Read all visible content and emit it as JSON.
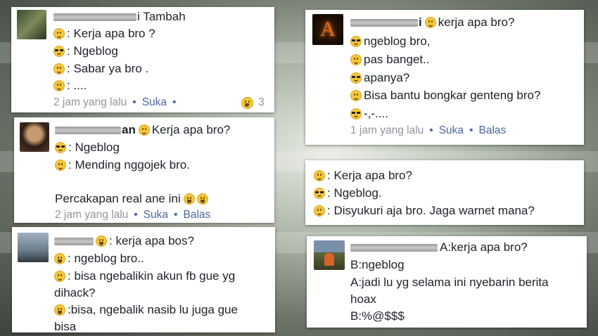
{
  "card1": {
    "name_suffix": "i Tambah",
    "lines": [
      ": Kerja apa bro ?",
      ": Ngeblog",
      ": Sabar ya bro .",
      ": ...."
    ],
    "time": "2 jam yang lalu",
    "like": "Suka",
    "reaction_count": "3"
  },
  "card2": {
    "name_suffix": "an",
    "header_text": "Kerja apa bro?",
    "lines": [
      ": Ngeblog",
      ": Mending nggojek bro."
    ],
    "note": "Percakapan real ane ini",
    "time": "2 jam yang lalu",
    "like": "Suka",
    "reply": "Balas"
  },
  "card3": {
    "header_text": ": kerja apa bos?",
    "lines": [
      ": ngeblog bro..",
      ": bisa ngebalikin akun fb gue yg",
      "dihack?",
      ":bisa, ngebalik nasib lu juga gue",
      "bisa"
    ]
  },
  "card4": {
    "header_text": "kerja apa bro?",
    "lines": [
      "ngeblog bro,",
      "pas banget..",
      "apanya?",
      "Bisa bantu bongkar genteng bro?",
      "-,-...."
    ],
    "time": "1 jam yang lalu",
    "like": "Suka",
    "reply": "Balas",
    "avatar_letter": "A"
  },
  "card5": {
    "lines": [
      ": Kerja apa bro?",
      ": Ngeblog.",
      ": Disyukuri aja bro. Jaga warnet mana?"
    ]
  },
  "card6": {
    "header_text": "A:kerja apa bro?",
    "lines": [
      "B:ngeblog",
      "A:jadi lu yg selama ini nyebarin berita",
      "hoax",
      "B:%@$$$"
    ]
  }
}
